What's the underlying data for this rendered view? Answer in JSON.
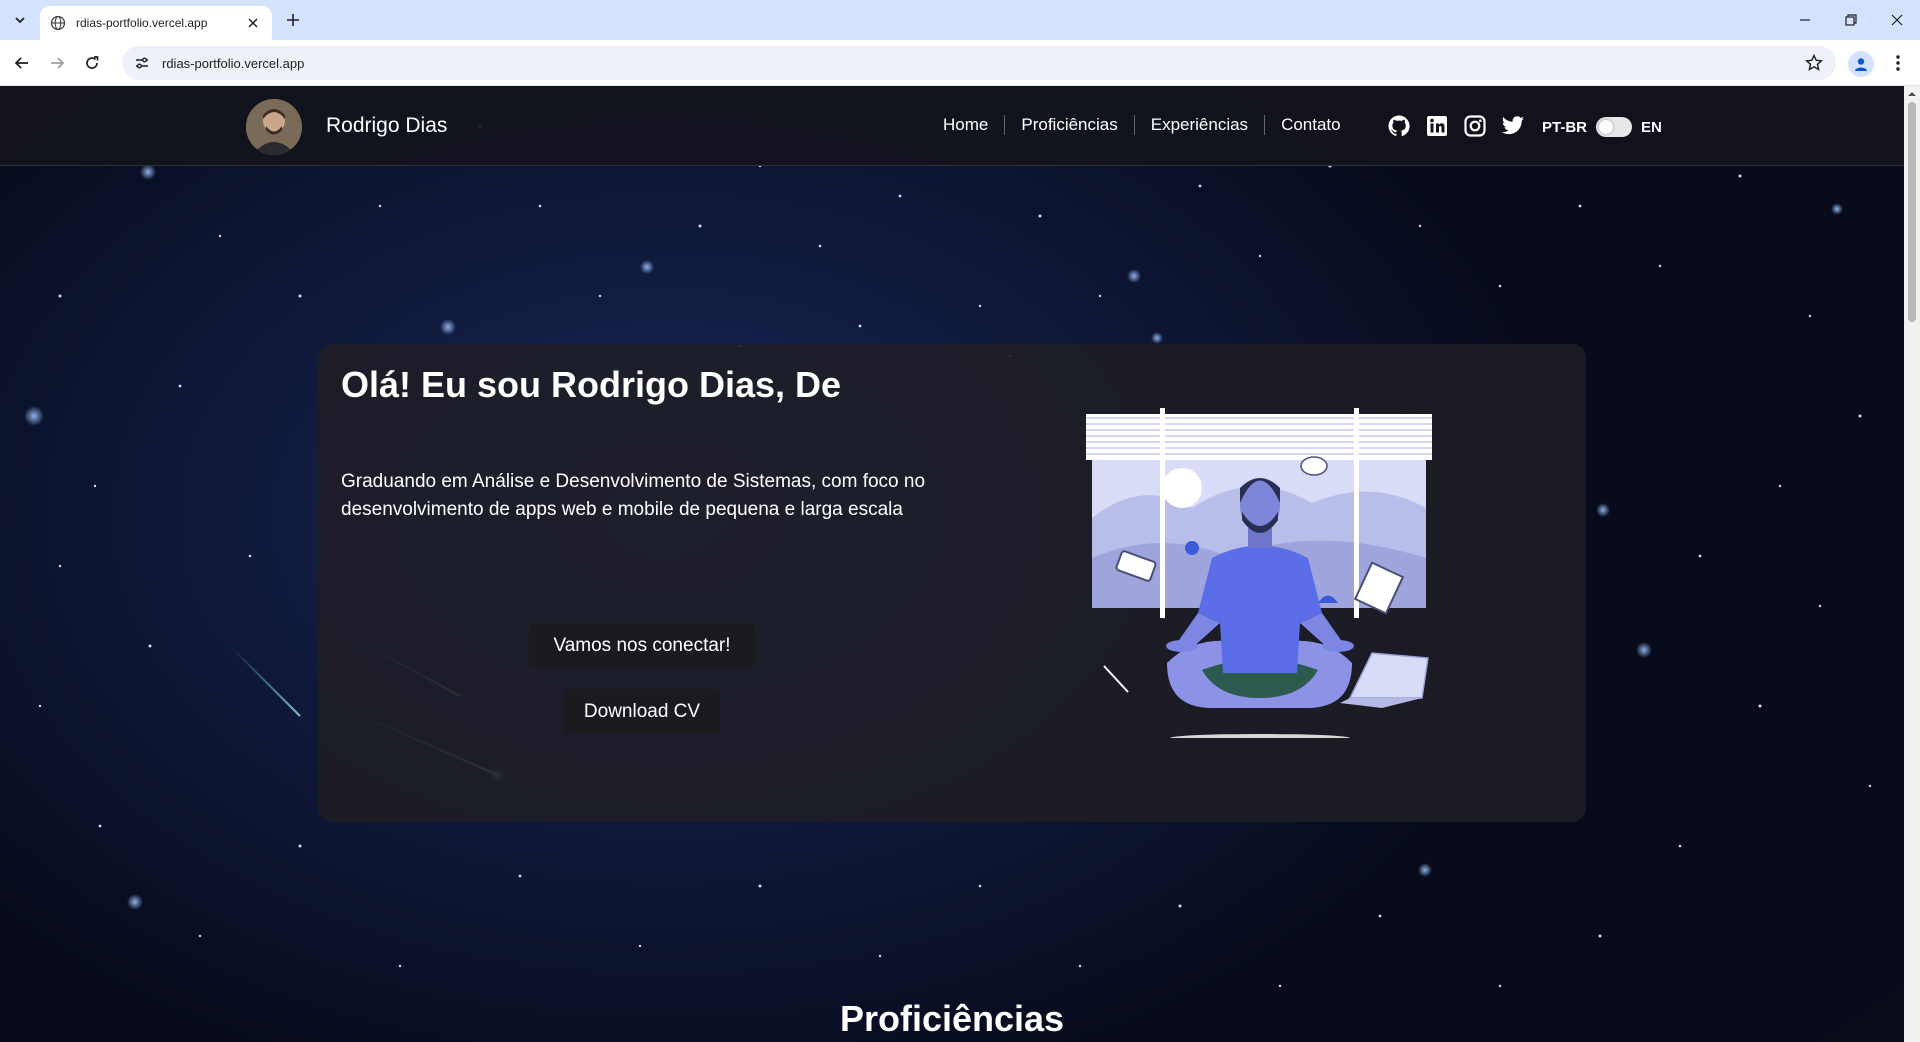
{
  "browser": {
    "tab_title": "rdias-portfolio.vercel.app",
    "url": "rdias-portfolio.vercel.app",
    "icons": [
      "tab-list-icon",
      "globe-icon",
      "close-icon",
      "plus-icon",
      "minimize-icon",
      "restore-icon",
      "close-window-icon",
      "back-icon",
      "forward-icon",
      "reload-icon",
      "site-info-icon",
      "star-icon",
      "profile-icon",
      "menu-icon"
    ]
  },
  "site": {
    "brand": "Rodrigo Dias",
    "nav": [
      {
        "label": "Home"
      },
      {
        "label": "Proficiências"
      },
      {
        "label": "Experiências"
      },
      {
        "label": "Contato"
      }
    ],
    "social_icons": [
      "github-icon",
      "linkedin-icon",
      "instagram-icon",
      "twitter-icon"
    ],
    "lang_left": "PT-BR",
    "lang_right": "EN"
  },
  "hero": {
    "title": "Olá! Eu sou Rodrigo Dias, De",
    "subtitle": "Graduando em Análise e Desenvolvimento de Sistemas, com foco no desenvolvimento de apps web e mobile de pequena e larga escala",
    "connect_label": "Vamos nos conectar!",
    "cv_label": "Download CV"
  },
  "sections": {
    "next_title": "Proficiências"
  },
  "colors": {
    "tabbar": "#d3e3fd",
    "accent_illustration": "#5b6ee8",
    "card": "#1e1e24"
  }
}
